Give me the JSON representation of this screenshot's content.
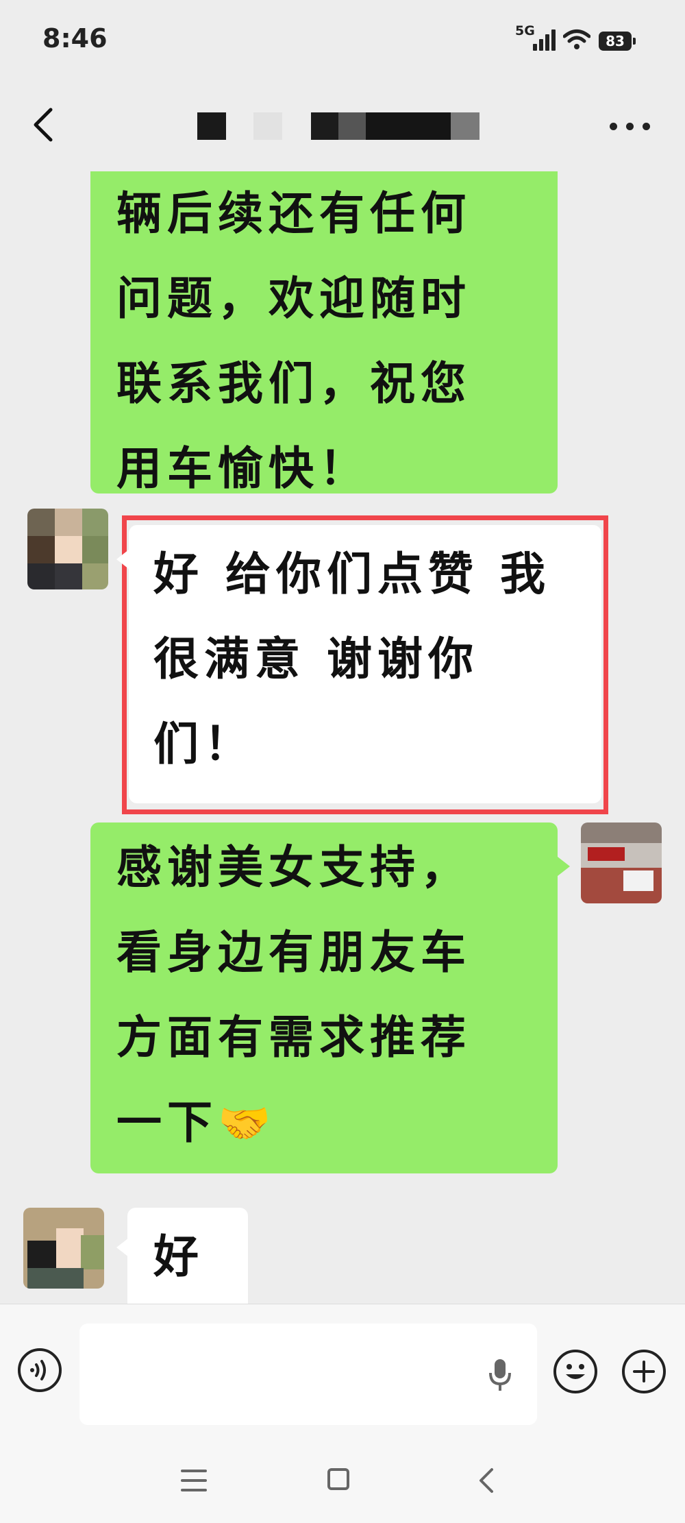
{
  "status_bar": {
    "time": "8:46",
    "network": "5G",
    "battery": "83"
  },
  "header": {
    "title": ""
  },
  "messages": [
    {
      "side": "right",
      "text_lines": [
        "辆后续还有任何",
        "问题，欢迎随时",
        "联系我们，祝您",
        "用车愉快！"
      ]
    },
    {
      "side": "left",
      "highlighted": true,
      "text_lines": [
        "好 给你们点赞 我",
        "很满意 谢谢你",
        "们！"
      ]
    },
    {
      "side": "right",
      "text_lines": [
        "感谢美女支持，",
        "看身边有朋友车",
        "方面有需求推荐",
        "一下"
      ],
      "trailing_emoji": "🤝"
    },
    {
      "side": "left",
      "text_lines": [
        "好"
      ]
    }
  ],
  "colors": {
    "self_bubble": "#95ec69",
    "other_bubble": "#ffffff",
    "highlight_border": "#f0454b",
    "background": "#ededed"
  },
  "icons": [
    "back-arrow-icon",
    "more-icon",
    "voice-icon",
    "microphone-icon",
    "emoji-icon",
    "plus-icon",
    "nav-menu-icon",
    "nav-home-icon",
    "nav-back-icon"
  ]
}
